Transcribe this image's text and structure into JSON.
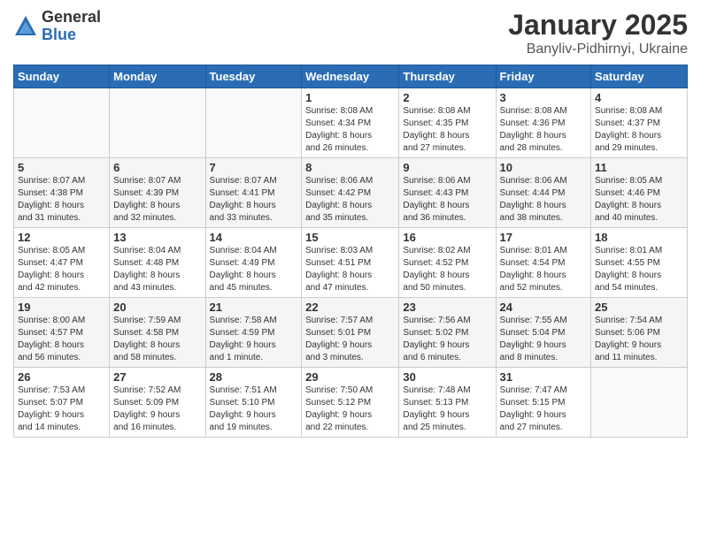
{
  "logo": {
    "general": "General",
    "blue": "Blue"
  },
  "header": {
    "month": "January 2025",
    "location": "Banyliv-Pidhirnyi, Ukraine"
  },
  "weekdays": [
    "Sunday",
    "Monday",
    "Tuesday",
    "Wednesday",
    "Thursday",
    "Friday",
    "Saturday"
  ],
  "weeks": [
    [
      {
        "day": "",
        "info": ""
      },
      {
        "day": "",
        "info": ""
      },
      {
        "day": "",
        "info": ""
      },
      {
        "day": "1",
        "info": "Sunrise: 8:08 AM\nSunset: 4:34 PM\nDaylight: 8 hours\nand 26 minutes."
      },
      {
        "day": "2",
        "info": "Sunrise: 8:08 AM\nSunset: 4:35 PM\nDaylight: 8 hours\nand 27 minutes."
      },
      {
        "day": "3",
        "info": "Sunrise: 8:08 AM\nSunset: 4:36 PM\nDaylight: 8 hours\nand 28 minutes."
      },
      {
        "day": "4",
        "info": "Sunrise: 8:08 AM\nSunset: 4:37 PM\nDaylight: 8 hours\nand 29 minutes."
      }
    ],
    [
      {
        "day": "5",
        "info": "Sunrise: 8:07 AM\nSunset: 4:38 PM\nDaylight: 8 hours\nand 31 minutes."
      },
      {
        "day": "6",
        "info": "Sunrise: 8:07 AM\nSunset: 4:39 PM\nDaylight: 8 hours\nand 32 minutes."
      },
      {
        "day": "7",
        "info": "Sunrise: 8:07 AM\nSunset: 4:41 PM\nDaylight: 8 hours\nand 33 minutes."
      },
      {
        "day": "8",
        "info": "Sunrise: 8:06 AM\nSunset: 4:42 PM\nDaylight: 8 hours\nand 35 minutes."
      },
      {
        "day": "9",
        "info": "Sunrise: 8:06 AM\nSunset: 4:43 PM\nDaylight: 8 hours\nand 36 minutes."
      },
      {
        "day": "10",
        "info": "Sunrise: 8:06 AM\nSunset: 4:44 PM\nDaylight: 8 hours\nand 38 minutes."
      },
      {
        "day": "11",
        "info": "Sunrise: 8:05 AM\nSunset: 4:46 PM\nDaylight: 8 hours\nand 40 minutes."
      }
    ],
    [
      {
        "day": "12",
        "info": "Sunrise: 8:05 AM\nSunset: 4:47 PM\nDaylight: 8 hours\nand 42 minutes."
      },
      {
        "day": "13",
        "info": "Sunrise: 8:04 AM\nSunset: 4:48 PM\nDaylight: 8 hours\nand 43 minutes."
      },
      {
        "day": "14",
        "info": "Sunrise: 8:04 AM\nSunset: 4:49 PM\nDaylight: 8 hours\nand 45 minutes."
      },
      {
        "day": "15",
        "info": "Sunrise: 8:03 AM\nSunset: 4:51 PM\nDaylight: 8 hours\nand 47 minutes."
      },
      {
        "day": "16",
        "info": "Sunrise: 8:02 AM\nSunset: 4:52 PM\nDaylight: 8 hours\nand 50 minutes."
      },
      {
        "day": "17",
        "info": "Sunrise: 8:01 AM\nSunset: 4:54 PM\nDaylight: 8 hours\nand 52 minutes."
      },
      {
        "day": "18",
        "info": "Sunrise: 8:01 AM\nSunset: 4:55 PM\nDaylight: 8 hours\nand 54 minutes."
      }
    ],
    [
      {
        "day": "19",
        "info": "Sunrise: 8:00 AM\nSunset: 4:57 PM\nDaylight: 8 hours\nand 56 minutes."
      },
      {
        "day": "20",
        "info": "Sunrise: 7:59 AM\nSunset: 4:58 PM\nDaylight: 8 hours\nand 58 minutes."
      },
      {
        "day": "21",
        "info": "Sunrise: 7:58 AM\nSunset: 4:59 PM\nDaylight: 9 hours\nand 1 minute."
      },
      {
        "day": "22",
        "info": "Sunrise: 7:57 AM\nSunset: 5:01 PM\nDaylight: 9 hours\nand 3 minutes."
      },
      {
        "day": "23",
        "info": "Sunrise: 7:56 AM\nSunset: 5:02 PM\nDaylight: 9 hours\nand 6 minutes."
      },
      {
        "day": "24",
        "info": "Sunrise: 7:55 AM\nSunset: 5:04 PM\nDaylight: 9 hours\nand 8 minutes."
      },
      {
        "day": "25",
        "info": "Sunrise: 7:54 AM\nSunset: 5:06 PM\nDaylight: 9 hours\nand 11 minutes."
      }
    ],
    [
      {
        "day": "26",
        "info": "Sunrise: 7:53 AM\nSunset: 5:07 PM\nDaylight: 9 hours\nand 14 minutes."
      },
      {
        "day": "27",
        "info": "Sunrise: 7:52 AM\nSunset: 5:09 PM\nDaylight: 9 hours\nand 16 minutes."
      },
      {
        "day": "28",
        "info": "Sunrise: 7:51 AM\nSunset: 5:10 PM\nDaylight: 9 hours\nand 19 minutes."
      },
      {
        "day": "29",
        "info": "Sunrise: 7:50 AM\nSunset: 5:12 PM\nDaylight: 9 hours\nand 22 minutes."
      },
      {
        "day": "30",
        "info": "Sunrise: 7:48 AM\nSunset: 5:13 PM\nDaylight: 9 hours\nand 25 minutes."
      },
      {
        "day": "31",
        "info": "Sunrise: 7:47 AM\nSunset: 5:15 PM\nDaylight: 9 hours\nand 27 minutes."
      },
      {
        "day": "",
        "info": ""
      }
    ]
  ]
}
